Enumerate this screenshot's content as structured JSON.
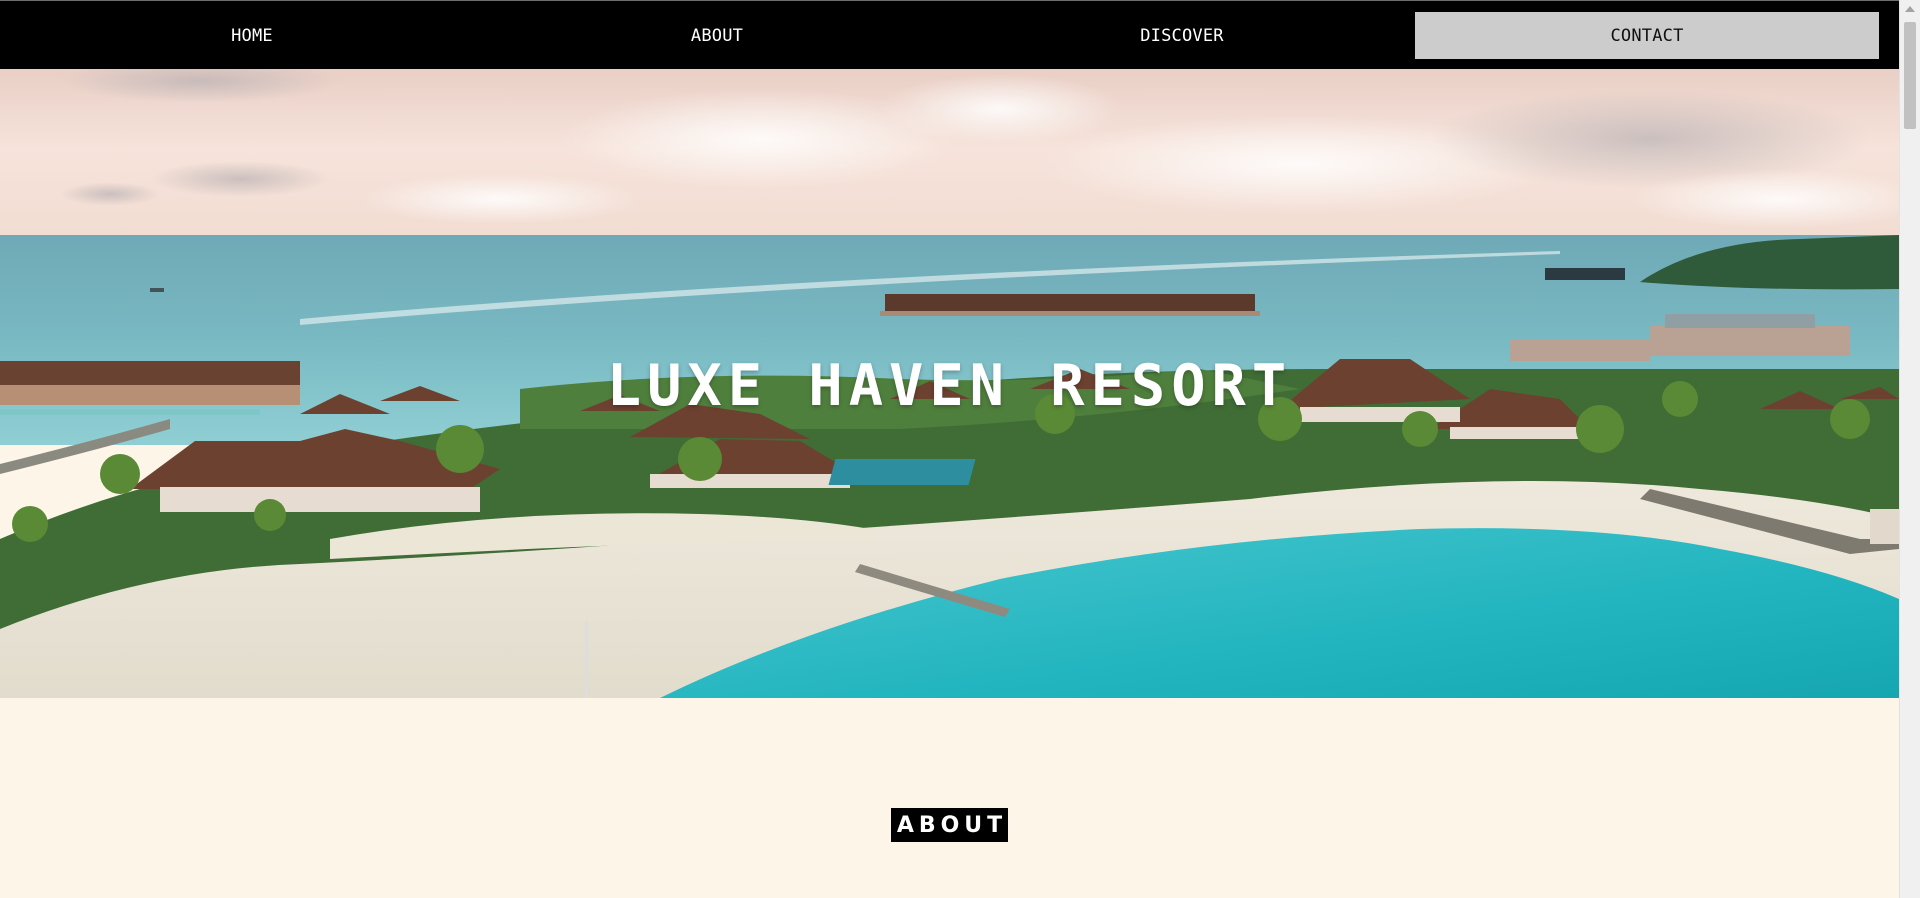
{
  "nav": {
    "items": [
      {
        "label": "HOME"
      },
      {
        "label": "ABOUT"
      },
      {
        "label": "DISCOVER"
      },
      {
        "label": "CONTACT"
      }
    ],
    "active_index": 3,
    "background": "#000000",
    "active_background": "#cccccc"
  },
  "hero": {
    "title": "LUXE HAVEN RESORT",
    "image_description_icon": "island-resort-image"
  },
  "about": {
    "heading": "ABOUT",
    "background": "#fcf5e8"
  },
  "icons": {
    "scroll_up": "triangle-up"
  }
}
